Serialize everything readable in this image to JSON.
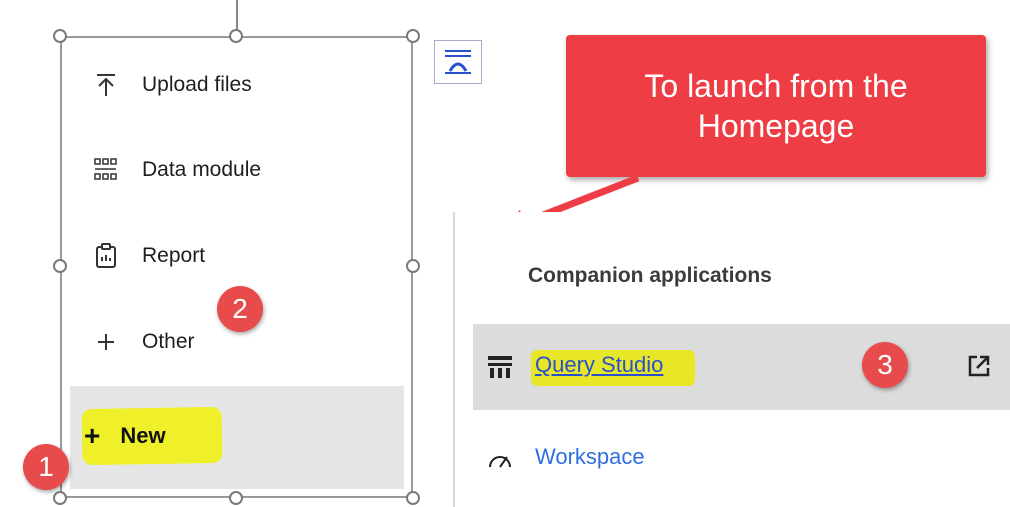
{
  "new_menu": {
    "items": [
      {
        "label": "Upload files",
        "icon": "upload-icon"
      },
      {
        "label": "Data module",
        "icon": "data-module-icon"
      },
      {
        "label": "Report",
        "icon": "report-icon"
      },
      {
        "label": "Other",
        "icon": "plus-icon"
      }
    ],
    "new_label": "New",
    "new_icon": "plus-icon"
  },
  "badges": {
    "one": "1",
    "two": "2",
    "three": "3"
  },
  "callout": {
    "line1": "To launch from the",
    "line2": "Homepage"
  },
  "companion": {
    "title": "Companion applications",
    "items": [
      {
        "label": "Query Studio",
        "icon": "query-studio-icon",
        "action_icon": "external-launch-icon"
      },
      {
        "label": "Workspace",
        "icon": "gauge-icon"
      }
    ]
  },
  "colors": {
    "callout": "#ee3d45",
    "badge": "#e84b4b",
    "highlight": "#f0f02a",
    "link": "#2a4fd0"
  }
}
